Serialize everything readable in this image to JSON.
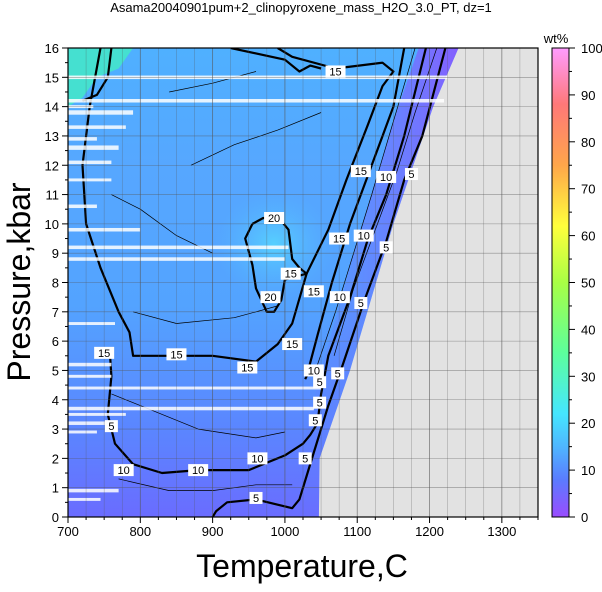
{
  "chart_data": {
    "type": "heatmap",
    "title": "Asama20040901pum+2_clinopyroxene_mass_H2O_3.0_PT, dz=1",
    "xlabel": "Temperature,C",
    "ylabel": "Pressure,kbar",
    "xlim": [
      700,
      1350
    ],
    "ylim": [
      0,
      16
    ],
    "x_ticks": [
      700,
      800,
      900,
      1000,
      1100,
      1200,
      1300
    ],
    "y_ticks": [
      0,
      1,
      2,
      3,
      4,
      5,
      6,
      7,
      8,
      9,
      10,
      11,
      12,
      13,
      14,
      15,
      16
    ],
    "grid": true,
    "colorbar": {
      "label": "wt%",
      "range": [
        0,
        100
      ],
      "ticks": [
        0,
        10,
        20,
        30,
        40,
        50,
        60,
        70,
        80,
        90,
        100
      ],
      "stops": [
        {
          "v": 0,
          "c": "#9a4cff"
        },
        {
          "v": 8,
          "c": "#5a7cff"
        },
        {
          "v": 15,
          "c": "#4fb6ff"
        },
        {
          "v": 22,
          "c": "#45e6ff"
        },
        {
          "v": 35,
          "c": "#5cff9c"
        },
        {
          "v": 50,
          "c": "#a8ff45"
        },
        {
          "v": 62,
          "c": "#ffff3c"
        },
        {
          "v": 75,
          "c": "#ffa64a"
        },
        {
          "v": 88,
          "c": "#ff7878"
        },
        {
          "v": 100,
          "c": "#ff9cff"
        }
      ]
    },
    "no_data_color": "#e2e2e2",
    "contour_labels": [
      {
        "value": "15",
        "t": 1070,
        "p": 15.2
      },
      {
        "value": "15",
        "t": 1105,
        "p": 11.8
      },
      {
        "value": "15",
        "t": 1075,
        "p": 9.5
      },
      {
        "value": "15",
        "t": 1040,
        "p": 7.7
      },
      {
        "value": "15",
        "t": 1010,
        "p": 5.9
      },
      {
        "value": "15",
        "t": 1008,
        "p": 8.3
      },
      {
        "value": "15",
        "t": 750,
        "p": 5.6
      },
      {
        "value": "15",
        "t": 850,
        "p": 5.55
      },
      {
        "value": "15",
        "t": 948,
        "p": 5.1
      },
      {
        "value": "20",
        "t": 985,
        "p": 10.2
      },
      {
        "value": "20",
        "t": 980,
        "p": 7.5
      },
      {
        "value": "10",
        "t": 1140,
        "p": 11.6
      },
      {
        "value": "10",
        "t": 1109,
        "p": 9.6
      },
      {
        "value": "10",
        "t": 1076,
        "p": 7.5
      },
      {
        "value": "10",
        "t": 1040,
        "p": 5.0
      },
      {
        "value": "10",
        "t": 777,
        "p": 1.6
      },
      {
        "value": "10",
        "t": 880,
        "p": 1.6
      },
      {
        "value": "10",
        "t": 962,
        "p": 2.0
      },
      {
        "value": "5",
        "t": 1175,
        "p": 11.7
      },
      {
        "value": "5",
        "t": 1140,
        "p": 9.2
      },
      {
        "value": "5",
        "t": 1105,
        "p": 7.3
      },
      {
        "value": "5",
        "t": 1073,
        "p": 4.9
      },
      {
        "value": "5",
        "t": 1048,
        "p": 4.6
      },
      {
        "value": "5",
        "t": 1048,
        "p": 3.9
      },
      {
        "value": "5",
        "t": 1042,
        "p": 3.3
      },
      {
        "value": "5",
        "t": 1028,
        "p": 2.0
      },
      {
        "value": "5",
        "t": 760,
        "p": 3.1
      },
      {
        "value": "5",
        "t": 960,
        "p": 0.65
      }
    ]
  }
}
